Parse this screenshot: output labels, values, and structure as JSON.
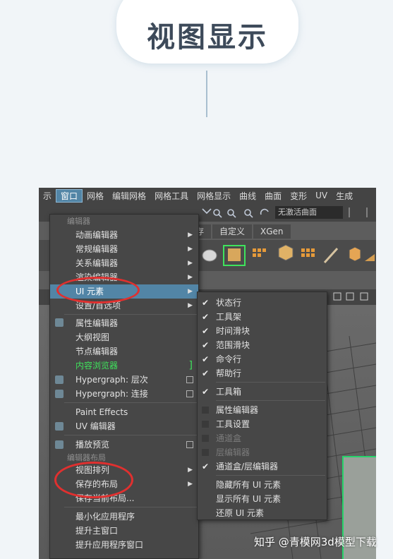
{
  "header": {
    "title": "视图显示"
  },
  "maya": {
    "menubar": [
      "窗口",
      "网格",
      "编辑网格",
      "网格工具",
      "网格显示",
      "曲线",
      "曲面",
      "变形",
      "UV",
      "生成"
    ],
    "live_surface": "无激活曲面",
    "shelf_tabs": [
      "渲存",
      "自定义",
      "XGen"
    ],
    "window_menu": {
      "sections": {
        "editors": "编辑器",
        "layouts": "编辑器布局"
      },
      "items": [
        "动画编辑器",
        "常规编辑器",
        "关系编辑器",
        "渲染编辑器",
        "UI 元素",
        "设置/首选项",
        "属性编辑器",
        "大纲视图",
        "节点编辑器",
        "内容浏览器",
        "Hypergraph: 层次",
        "Hypergraph: 连接",
        "Paint Effects",
        "UV 编辑器",
        "播放预览",
        "视图排列",
        "保存的布局",
        "保存当前布局...",
        "最小化应用程序",
        "提升主窗口",
        "提升应用程序窗口"
      ]
    },
    "ui_elements_menu": {
      "items": [
        "状态行",
        "工具架",
        "时间滑块",
        "范围滑块",
        "命令行",
        "帮助行",
        "工具箱",
        "属性编辑器",
        "工具设置",
        "通道盒",
        "层编辑器",
        "通道盒/层编辑器",
        "隐藏所有 UI 元素",
        "显示所有 UI 元素",
        "还原 UI 元素"
      ]
    }
  },
  "watermark": "知乎 @青模网3d模型下载"
}
